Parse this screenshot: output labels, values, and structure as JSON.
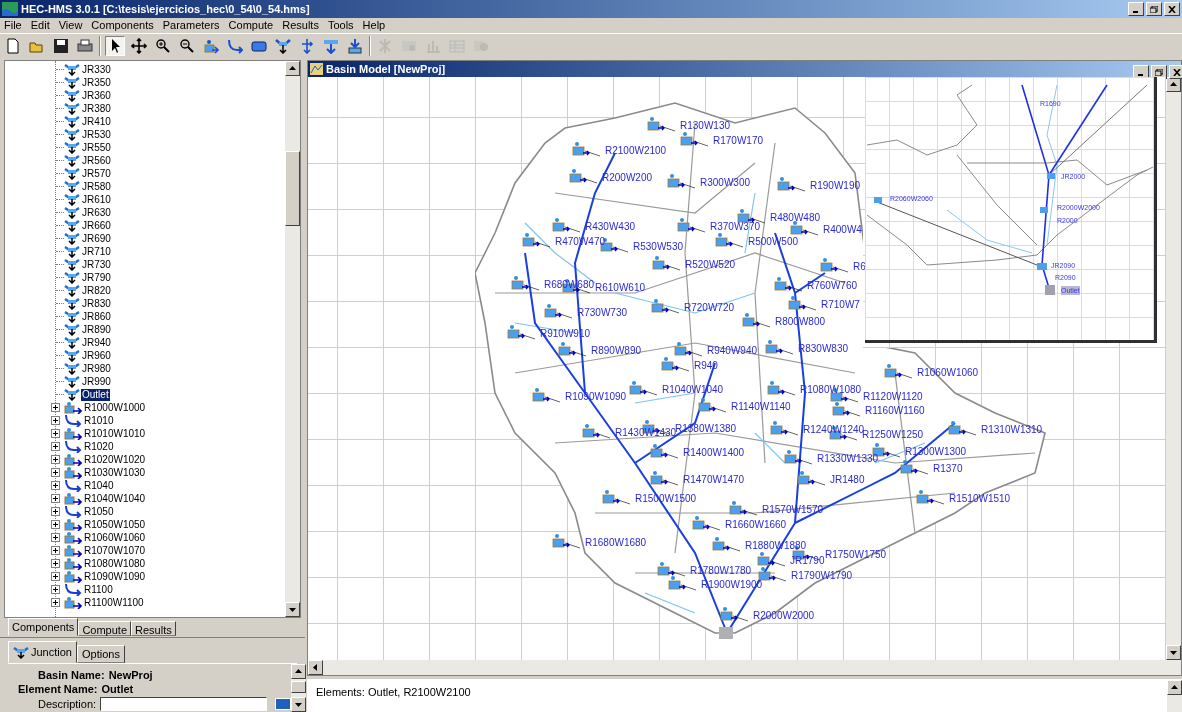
{
  "window": {
    "title": "HEC-HMS 3.0.1 [C:\\tesis\\ejercicios_hec\\0_54\\0_54.hms]"
  },
  "menu": [
    "File",
    "Edit",
    "View",
    "Components",
    "Parameters",
    "Compute",
    "Results",
    "Tools",
    "Help"
  ],
  "toolbar": [
    {
      "kind": "new",
      "disabled": false,
      "selected": false
    },
    {
      "kind": "open",
      "disabled": false,
      "selected": false
    },
    {
      "kind": "save",
      "disabled": false,
      "selected": false
    },
    {
      "kind": "print",
      "disabled": false,
      "selected": false
    },
    {
      "kind": "separator"
    },
    {
      "kind": "arrow",
      "disabled": false,
      "selected": true
    },
    {
      "kind": "pan",
      "disabled": false,
      "selected": false
    },
    {
      "kind": "zoom-in",
      "disabled": false,
      "selected": false
    },
    {
      "kind": "zoom-out",
      "disabled": false,
      "selected": false
    },
    {
      "kind": "subbasin",
      "disabled": false,
      "selected": false
    },
    {
      "kind": "reach",
      "disabled": false,
      "selected": false
    },
    {
      "kind": "reservoir",
      "disabled": false,
      "selected": false
    },
    {
      "kind": "junction",
      "disabled": false,
      "selected": false
    },
    {
      "kind": "diversion",
      "disabled": false,
      "selected": false
    },
    {
      "kind": "sink",
      "disabled": false,
      "selected": false
    },
    {
      "kind": "source",
      "disabled": false,
      "selected": false
    },
    {
      "kind": "separator"
    },
    {
      "kind": "compute",
      "disabled": true,
      "selected": false
    },
    {
      "kind": "summary",
      "disabled": true,
      "selected": false
    },
    {
      "kind": "graph",
      "disabled": true,
      "selected": false
    },
    {
      "kind": "table",
      "disabled": true,
      "selected": false
    },
    {
      "kind": "message",
      "disabled": true,
      "selected": false
    }
  ],
  "tree": [
    {
      "label": "JR330",
      "kind": "junction",
      "expandable": false,
      "selected": false
    },
    {
      "label": "JR350",
      "kind": "junction",
      "expandable": false,
      "selected": false
    },
    {
      "label": "JR360",
      "kind": "junction",
      "expandable": false,
      "selected": false
    },
    {
      "label": "JR380",
      "kind": "junction",
      "expandable": false,
      "selected": false
    },
    {
      "label": "JR410",
      "kind": "junction",
      "expandable": false,
      "selected": false
    },
    {
      "label": "JR530",
      "kind": "junction",
      "expandable": false,
      "selected": false
    },
    {
      "label": "JR550",
      "kind": "junction",
      "expandable": false,
      "selected": false
    },
    {
      "label": "JR560",
      "kind": "junction",
      "expandable": false,
      "selected": false
    },
    {
      "label": "JR570",
      "kind": "junction",
      "expandable": false,
      "selected": false
    },
    {
      "label": "JR580",
      "kind": "junction",
      "expandable": false,
      "selected": false
    },
    {
      "label": "JR610",
      "kind": "junction",
      "expandable": false,
      "selected": false
    },
    {
      "label": "JR630",
      "kind": "junction",
      "expandable": false,
      "selected": false
    },
    {
      "label": "JR660",
      "kind": "junction",
      "expandable": false,
      "selected": false
    },
    {
      "label": "JR690",
      "kind": "junction",
      "expandable": false,
      "selected": false
    },
    {
      "label": "JR710",
      "kind": "junction",
      "expandable": false,
      "selected": false
    },
    {
      "label": "JR730",
      "kind": "junction",
      "expandable": false,
      "selected": false
    },
    {
      "label": "JR790",
      "kind": "junction",
      "expandable": false,
      "selected": false
    },
    {
      "label": "JR820",
      "kind": "junction",
      "expandable": false,
      "selected": false
    },
    {
      "label": "JR830",
      "kind": "junction",
      "expandable": false,
      "selected": false
    },
    {
      "label": "JR860",
      "kind": "junction",
      "expandable": false,
      "selected": false
    },
    {
      "label": "JR890",
      "kind": "junction",
      "expandable": false,
      "selected": false
    },
    {
      "label": "JR940",
      "kind": "junction",
      "expandable": false,
      "selected": false
    },
    {
      "label": "JR960",
      "kind": "junction",
      "expandable": false,
      "selected": false
    },
    {
      "label": "JR980",
      "kind": "junction",
      "expandable": false,
      "selected": false
    },
    {
      "label": "JR990",
      "kind": "junction",
      "expandable": false,
      "selected": false
    },
    {
      "label": "Outlet",
      "kind": "junction",
      "expandable": false,
      "selected": true
    },
    {
      "label": "R1000W1000",
      "kind": "subbasin",
      "expandable": true,
      "selected": false
    },
    {
      "label": "R1010",
      "kind": "reach",
      "expandable": true,
      "selected": false
    },
    {
      "label": "R1010W1010",
      "kind": "subbasin",
      "expandable": true,
      "selected": false
    },
    {
      "label": "R1020",
      "kind": "reach",
      "expandable": true,
      "selected": false
    },
    {
      "label": "R1020W1020",
      "kind": "subbasin",
      "expandable": true,
      "selected": false
    },
    {
      "label": "R1030W1030",
      "kind": "subbasin",
      "expandable": true,
      "selected": false
    },
    {
      "label": "R1040",
      "kind": "reach",
      "expandable": true,
      "selected": false
    },
    {
      "label": "R1040W1040",
      "kind": "subbasin",
      "expandable": true,
      "selected": false
    },
    {
      "label": "R1050",
      "kind": "reach",
      "expandable": true,
      "selected": false
    },
    {
      "label": "R1050W1050",
      "kind": "subbasin",
      "expandable": true,
      "selected": false
    },
    {
      "label": "R1060W1060",
      "kind": "subbasin",
      "expandable": true,
      "selected": false
    },
    {
      "label": "R1070W1070",
      "kind": "subbasin",
      "expandable": true,
      "selected": false
    },
    {
      "label": "R1080W1080",
      "kind": "subbasin",
      "expandable": true,
      "selected": false
    },
    {
      "label": "R1090W1090",
      "kind": "subbasin",
      "expandable": true,
      "selected": false
    },
    {
      "label": "R1100",
      "kind": "reach",
      "expandable": true,
      "selected": false
    },
    {
      "label": "R1100W1100",
      "kind": "subbasin",
      "expandable": true,
      "selected": false
    }
  ],
  "explorer_tabs": [
    {
      "label": "Components",
      "selected": true
    },
    {
      "label": "Compute",
      "selected": false
    },
    {
      "label": "Results",
      "selected": false
    }
  ],
  "editor_tabs": [
    {
      "label": "Junction",
      "selected": true
    },
    {
      "label": "Options",
      "selected": false
    }
  ],
  "editor": {
    "basin_label": "Basin Name:",
    "basin_value": "NewProj",
    "element_label": "Element Name:",
    "element_value": "Outlet",
    "description_label": "Description:"
  },
  "basin_window": {
    "title": "Basin Model [NewProj]",
    "labels": [
      "R130W130",
      "R2100W2100",
      "R170W170",
      "R200W200",
      "R300W300",
      "R190W190",
      "R480W480",
      "R430W430",
      "R370W370",
      "R400W4",
      "R470W470",
      "R500W500",
      "R530W530",
      "R520W520",
      "R6",
      "R680W680",
      "R610W610",
      "R760W760",
      "R710W7",
      "R730W730",
      "R720W720",
      "R800W800",
      "R910W910",
      "R890W890",
      "R940W940",
      "R830W830",
      "R940",
      "R1060W1060",
      "R1040W1040",
      "R1080W1080",
      "R1090W1090",
      "R1120W1120",
      "R1140W1140",
      "R1160W1160",
      "R1430W1430",
      "R1380W1380",
      "R1240W1240",
      "R1250W1250",
      "R1310W1310",
      "R1300W1300",
      "R1370",
      "R1400W1400",
      "R1330W1330",
      "JR1480",
      "R1470W1470",
      "R1510W1510",
      "R1500W1500",
      "R1570W1570",
      "R1660W1660",
      "R1680W1680",
      "R1880W1880",
      "R1750W1750",
      "JR1790",
      "R1780W1780",
      "R1790W1790",
      "R1900W1900",
      "R2000W2000"
    ],
    "overview": [
      {
        "label": "R1690",
        "selected": false
      },
      {
        "label": "JR2000",
        "selected": false
      },
      {
        "label": "R2060W2060",
        "selected": false
      },
      {
        "label": "R2000W2000",
        "selected": false
      },
      {
        "label": "R2000",
        "selected": false
      },
      {
        "label": "JR2090",
        "selected": false
      },
      {
        "label": "R2090",
        "selected": false
      },
      {
        "label": "Outlet",
        "selected": true
      }
    ]
  },
  "message_bar": "Elements: Outlet, R2100W2100"
}
